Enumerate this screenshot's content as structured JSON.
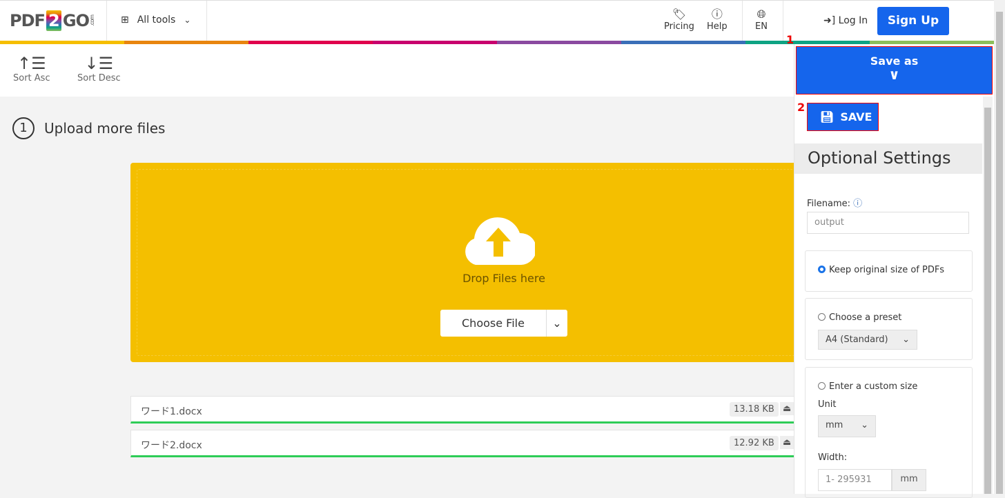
{
  "header": {
    "logo": "PDF2GO.com",
    "logo_parts": [
      "PDF",
      "2",
      "GO",
      ".com"
    ],
    "all_tools": "All tools",
    "pricing": "Pricing",
    "help": "Help",
    "language": "EN",
    "login": "Log In",
    "signup": "Sign Up"
  },
  "colors": {
    "accent": "#1565ec",
    "drop_zone": "#f4bf00",
    "progress": "#2ecc57",
    "bar": [
      "#f5be00",
      "#e8850f",
      "#e0004d",
      "#c8006e",
      "#8a4aa0",
      "#3a6fb8",
      "#0ea383",
      "#8cbf5a"
    ]
  },
  "toolbar": {
    "sort_asc": "Sort Asc",
    "sort_desc": "Sort Desc"
  },
  "upload": {
    "step_number": "1",
    "title": "Upload more files",
    "drop_text": "Drop Files here",
    "choose_file": "Choose File"
  },
  "files": [
    {
      "name": "ワード1.docx",
      "size": "13.18 KB",
      "progress": 100
    },
    {
      "name": "ワード2.docx",
      "size": "12.92 KB",
      "progress": 100
    }
  ],
  "panel": {
    "marker1": "1",
    "marker2": "2",
    "save_as": "Save as",
    "save": "SAVE",
    "optional_settings": "Optional Settings",
    "filename_label": "Filename:",
    "filename_placeholder": "output",
    "keep_original": "Keep original size of PDFs",
    "choose_preset": "Choose a preset",
    "preset_value": "A4 (Standard)",
    "custom_size": "Enter a custom size",
    "unit_label": "Unit",
    "unit_value": "mm",
    "width_label": "Width:",
    "width_placeholder": "1- 295931",
    "width_unit": "mm"
  }
}
